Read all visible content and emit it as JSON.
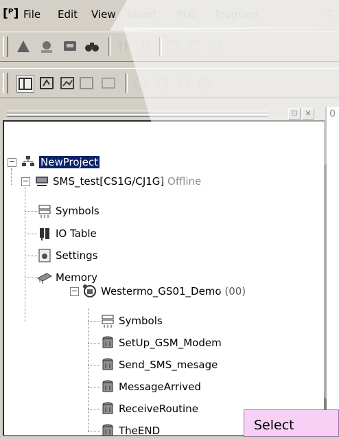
{
  "menu": {
    "items": [
      {
        "label": "File"
      },
      {
        "label": "Edit"
      },
      {
        "label": "View"
      },
      {
        "label": "Insert"
      },
      {
        "label": "PLC"
      },
      {
        "label": "Program"
      },
      {
        "label": "T"
      }
    ]
  },
  "right_pane": {
    "ruler_label": "0"
  },
  "tree": {
    "root": "NewProject",
    "plc": "SMS_test[CS1G/CJ1G] Offline",
    "plc_children": [
      {
        "label": "Symbols",
        "icon": "symbols-icon"
      },
      {
        "label": "IO Table",
        "icon": "io-table-icon"
      },
      {
        "label": "Settings",
        "icon": "settings-icon"
      },
      {
        "label": "Memory",
        "icon": "memory-icon"
      }
    ],
    "program": "Westermo_GS01_Demo (00)",
    "program_children": [
      {
        "label": "Symbols",
        "icon": "symbols-icon"
      },
      {
        "label": "SetUp_GSM_Modem",
        "icon": "section-icon"
      },
      {
        "label": "Send_SMS_mesage",
        "icon": "section-icon"
      },
      {
        "label": "MessageArrived",
        "icon": "section-icon"
      },
      {
        "label": "ReceiveRoutine",
        "icon": "section-icon"
      },
      {
        "label": "TheEND",
        "icon": "section-icon"
      }
    ]
  },
  "tooltip": {
    "text": "Select"
  },
  "colors": {
    "chrome": "#d4d0c8",
    "selection": "#0a246a",
    "tooltip": "#f7d0f5"
  }
}
